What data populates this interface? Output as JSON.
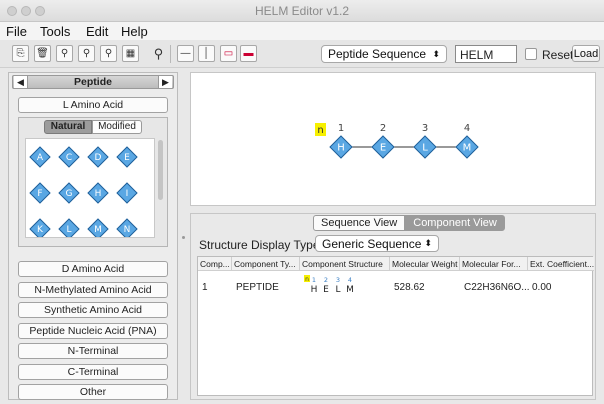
{
  "window": {
    "title": "HELM Editor v1.2"
  },
  "menubar": [
    "File",
    "Tools",
    "Edit",
    "Help"
  ],
  "toolbar": {
    "sequence_type": "Peptide Sequence",
    "notation": "HELM",
    "reset_label": "Reset",
    "load_label": "Load"
  },
  "monomer_panel": {
    "polymer_type": "Peptide",
    "l_amino_acid": "L Amino Acid",
    "tabs": [
      "Natural",
      "Modified"
    ],
    "monomers": [
      "A",
      "C",
      "D",
      "E",
      "F",
      "G",
      "H",
      "I",
      "K",
      "L",
      "M",
      "N"
    ],
    "categories": [
      "D Amino Acid",
      "N-Methylated Amino Acid",
      "Synthetic Amino Acid",
      "Peptide Nucleic Acid (PNA)",
      "N-Terminal",
      "C-Terminal",
      "Other"
    ]
  },
  "canvas": {
    "start_label": "n",
    "numbers": [
      "1",
      "2",
      "3",
      "4"
    ],
    "monomers": [
      "H",
      "E",
      "L",
      "M"
    ]
  },
  "bottom": {
    "tabs": [
      "Sequence View",
      "Component View"
    ],
    "structure_display_label": "Structure Display Type:",
    "structure_display_value": "Generic Sequence",
    "columns": [
      "Comp...",
      "Component Ty...",
      "Component Structure",
      "Molecular Weight",
      "Molecular For...",
      "Ext. Coefficient..."
    ],
    "row": {
      "comp": "1",
      "type": "PEPTIDE",
      "structure_numbers": [
        "1",
        "2",
        "3",
        "4"
      ],
      "structure_monomers": [
        "H",
        "E",
        "L",
        "M"
      ],
      "mw": "528.62",
      "formula": "C22H36N6O...",
      "ext": "0.00"
    }
  },
  "colors": {
    "monomer_fill": "#5aa7e3",
    "monomer_stroke": "#1d5f9a",
    "highlight": "#f7f000"
  }
}
